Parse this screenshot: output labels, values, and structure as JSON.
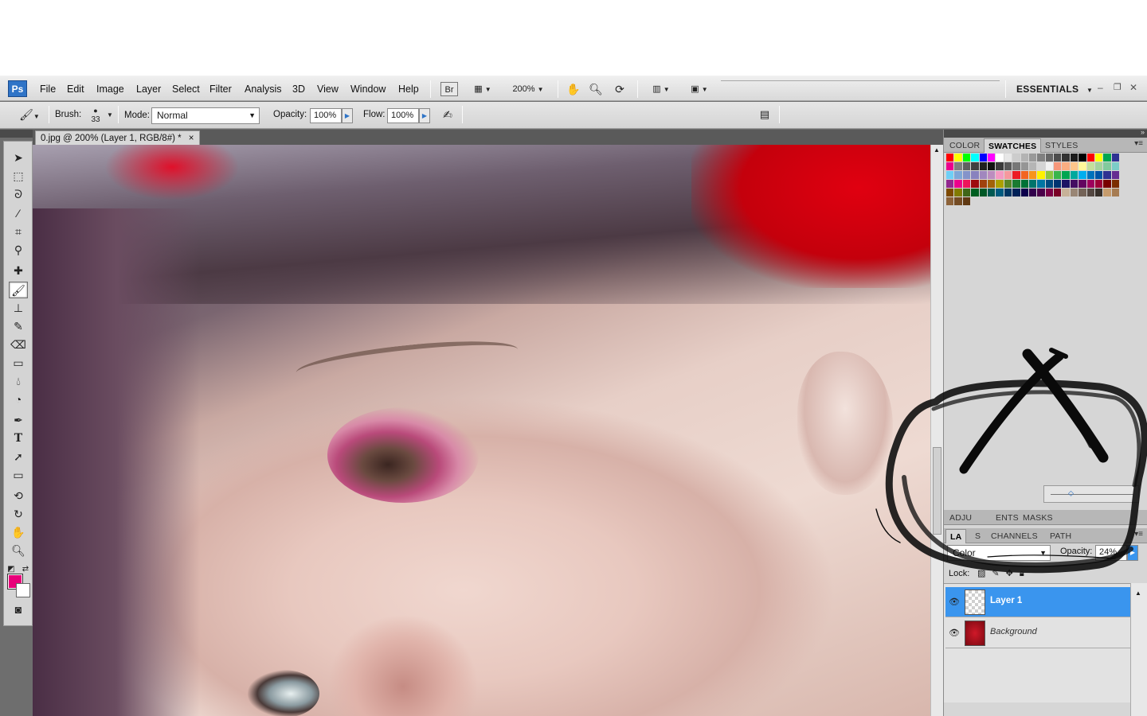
{
  "app": {
    "logo": "Ps"
  },
  "menu": [
    "File",
    "Edit",
    "Image",
    "Layer",
    "Select",
    "Filter",
    "Analysis",
    "3D",
    "View",
    "Window",
    "Help"
  ],
  "toolbar": {
    "bridge_label": "Br",
    "zoom_value": "200%",
    "workspace_label": "ESSENTIALS"
  },
  "options": {
    "brush_label": "Brush:",
    "brush_size": "33",
    "mode_label": "Mode:",
    "mode_value": "Normal",
    "opacity_label": "Opacity:",
    "opacity_value": "100%",
    "flow_label": "Flow:",
    "flow_value": "100%"
  },
  "document": {
    "tab_title": "0.jpg @ 200% (Layer 1, RGB/8#) *",
    "close_glyph": "×"
  },
  "colors": {
    "foreground": "#e8007a",
    "background": "#ffffff",
    "selected_layer": "#3a95ee"
  },
  "panels": {
    "color_group": {
      "tabs": [
        "COLOR",
        "SWATCHES",
        "STYLES"
      ],
      "active": "SWATCHES"
    },
    "adjust_group": {
      "tabs": [
        "ADJUSTMENTS",
        "MASKS"
      ],
      "visible_tabs": [
        "ADJU",
        "ENTS",
        "MASKS"
      ]
    },
    "layers_group": {
      "tabs": [
        "LAYERS",
        "CHANNELS",
        "PATHS"
      ],
      "visible_tabs": [
        "LA",
        "S",
        "CHANNELS",
        "PATH"
      ]
    }
  },
  "layers": {
    "blend_mode": "Color",
    "opacity_label": "Opacity:",
    "opacity_value": "24%",
    "lock_label": "Lock:",
    "items": [
      {
        "name": "Layer 1",
        "selected": true
      },
      {
        "name": "Background",
        "selected": false
      }
    ]
  },
  "swatches": [
    "#ff0000",
    "#ffff00",
    "#00ff00",
    "#00ffff",
    "#0000ff",
    "#ff00ff",
    "#ffffff",
    "#e6e6e6",
    "#cccccc",
    "#b3b3b3",
    "#999999",
    "#808080",
    "#666666",
    "#4d4d4d",
    "#333333",
    "#1a1a1a",
    "#000000",
    "#ff0000",
    "#ffff00",
    "#00a650",
    "#2e3192",
    "#ec008c",
    "#7f7f7f",
    "#606060",
    "#404040",
    "#202020",
    "#111111",
    "#3b3b3b",
    "#595959",
    "#777777",
    "#959595",
    "#b5b5b5",
    "#d4d4d4",
    "#f2f2f2",
    "#f7977a",
    "#f9ad81",
    "#fdc68a",
    "#fff79a",
    "#c4df9b",
    "#a3d39c",
    "#82ca9d",
    "#7bcdc8",
    "#6ecff6",
    "#7ea7d8",
    "#8493ca",
    "#8882be",
    "#a187be",
    "#bc8dbf",
    "#f49ac2",
    "#f6989d",
    "#ed1c24",
    "#f26522",
    "#f7941d",
    "#fff200",
    "#8dc63f",
    "#39b54a",
    "#00a651",
    "#00a99d",
    "#00aeef",
    "#0072bc",
    "#0054a6",
    "#2e3192",
    "#662d91",
    "#92278f",
    "#ec008c",
    "#ed145b",
    "#9e0b0f",
    "#a0410d",
    "#a36209",
    "#aba000",
    "#598527",
    "#1a7b30",
    "#007236",
    "#00746b",
    "#0076a3",
    "#004b80",
    "#003471",
    "#1b1464",
    "#440e62",
    "#630460",
    "#9e005d",
    "#9e0039",
    "#790000",
    "#7b2e00",
    "#7d4900",
    "#827b00",
    "#406618",
    "#005e20",
    "#005826",
    "#005952",
    "#005b7f",
    "#003663",
    "#002157",
    "#0d004c",
    "#32004b",
    "#4b0049",
    "#7b0046",
    "#7a0026",
    "#c7b299",
    "#998675",
    "#736357",
    "#534741",
    "#37302a",
    "#c69c6d",
    "#a67c52",
    "#8c6239",
    "#754c24",
    "#603913"
  ]
}
